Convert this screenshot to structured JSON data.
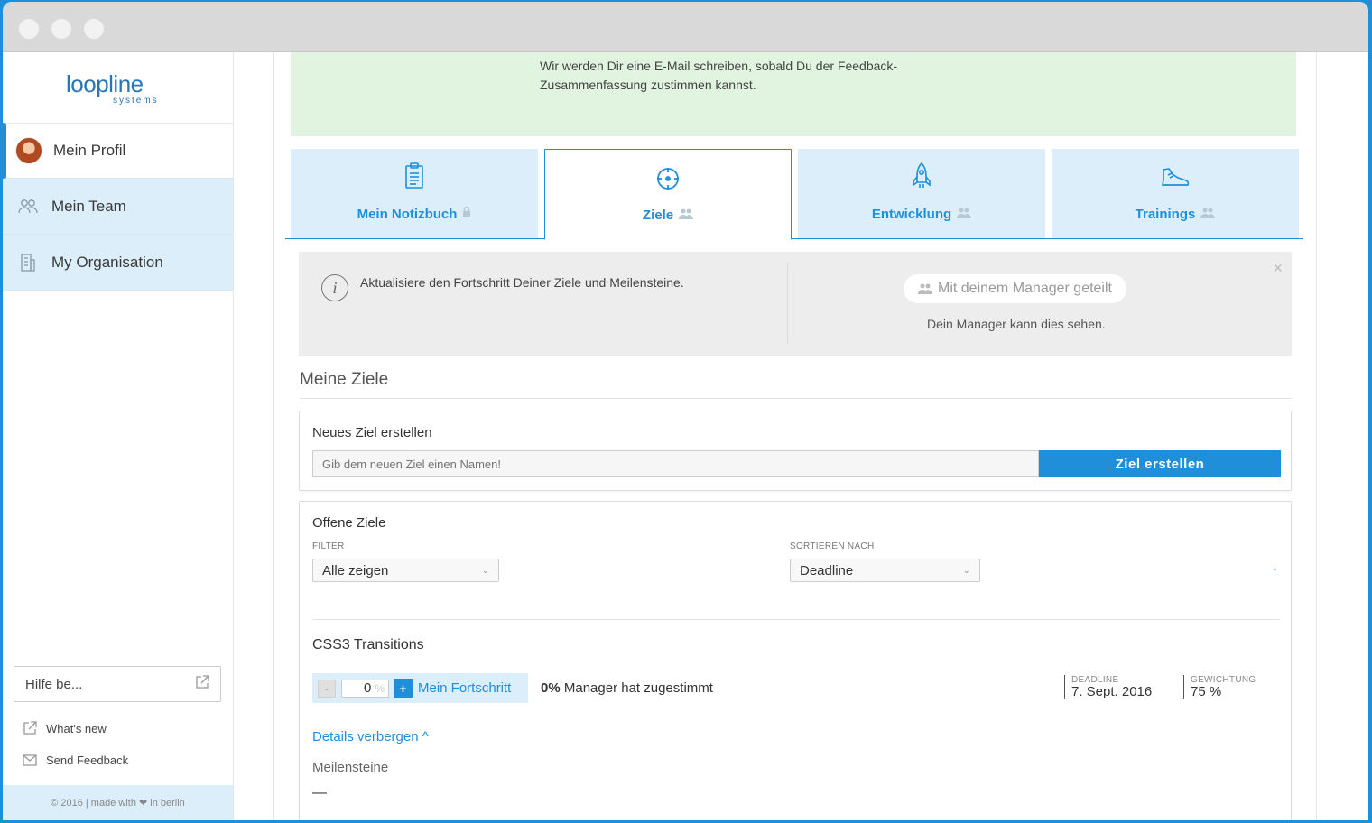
{
  "sidebar": {
    "logo": {
      "main": "loopline",
      "sub": "systems"
    },
    "items": [
      {
        "label": "Mein Profil"
      },
      {
        "label": "Mein Team"
      },
      {
        "label": "My Organisation"
      }
    ],
    "help_placeholder": "Hilfe be...",
    "links": [
      {
        "label": "What's new"
      },
      {
        "label": "Send Feedback"
      }
    ],
    "footer": "© 2016 | made with ❤ in berlin"
  },
  "notice": {
    "text": "Wir werden Dir eine E-Mail schreiben, sobald Du der Feedback-Zusammenfassung zustimmen kannst."
  },
  "tabs": [
    {
      "label": "Mein Notizbuch",
      "icon": "notebook-icon",
      "badge": "lock-icon"
    },
    {
      "label": "Ziele",
      "icon": "target-icon",
      "badge": "people-icon"
    },
    {
      "label": "Entwicklung",
      "icon": "rocket-icon",
      "badge": "people-icon"
    },
    {
      "label": "Trainings",
      "icon": "sneaker-icon",
      "badge": "people-icon"
    }
  ],
  "info": {
    "text": "Aktualisiere den Fortschritt Deiner Ziele und Meilensteine.",
    "share_pill": "Mit deinem Manager geteilt",
    "share_note": "Dein Manager kann dies sehen.",
    "close": "×"
  },
  "goals": {
    "title": "Meine Ziele",
    "new": {
      "title": "Neues Ziel erstellen",
      "placeholder": "Gib dem neuen Ziel einen Namen!",
      "button": "Ziel erstellen"
    },
    "open": {
      "title": "Offene Ziele",
      "filter_label": "FILTER",
      "filter_value": "Alle zeigen",
      "sort_label": "SORTIEREN NACH",
      "sort_value": "Deadline"
    },
    "item": {
      "title": "CSS3 Transitions",
      "minus": "-",
      "progress_value": "0",
      "progress_unit": "%",
      "plus": "+",
      "progress_label": "Mein Fortschritt",
      "approval_pct": "0%",
      "approval_text": "Manager hat zugestimmt",
      "deadline_label": "DEADLINE",
      "deadline_value": "7. Sept. 2016",
      "weight_label": "GEWICHTUNG",
      "weight_value": "75 %",
      "details_link": "Details verbergen ^",
      "milestones_label": "Meilensteine",
      "milestones_value": "—"
    }
  },
  "colors": {
    "accent": "#1e8fd8",
    "tab_bg": "#dbeef9",
    "success_bg": "#e0f4e0",
    "info_bg": "#ededed"
  }
}
